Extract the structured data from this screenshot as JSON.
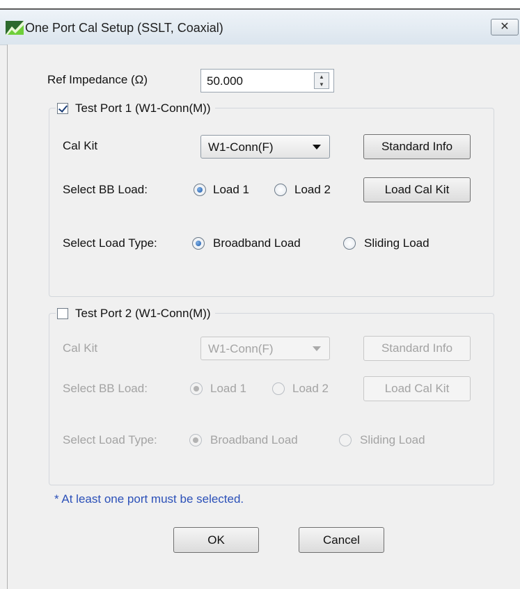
{
  "window": {
    "title": "One Port Cal Setup (SSLT, Coaxial)",
    "close_glyph": "✕"
  },
  "ref_impedance": {
    "label": "Ref Impedance (Ω)",
    "value": "50.000"
  },
  "port1": {
    "enabled": true,
    "checked": true,
    "label": "Test Port 1 (W1-Conn(M))",
    "cal_kit_label": "Cal Kit",
    "cal_kit_value": "W1-Conn(F)",
    "standard_info_button": "Standard Info",
    "bb_load_label": "Select BB Load:",
    "load1_label": "Load 1",
    "load2_label": "Load 2",
    "bb_load_selected": "Load 1",
    "load_cal_kit_button": "Load Cal Kit",
    "load_type_label": "Select Load Type:",
    "broadband_label": "Broadband Load",
    "sliding_label": "Sliding Load",
    "load_type_selected": "Broadband Load"
  },
  "port2": {
    "enabled": false,
    "checked": false,
    "label": "Test Port 2 (W1-Conn(M))",
    "cal_kit_label": "Cal Kit",
    "cal_kit_value": "W1-Conn(F)",
    "standard_info_button": "Standard Info",
    "bb_load_label": "Select BB Load:",
    "load1_label": "Load 1",
    "load2_label": "Load 2",
    "bb_load_selected": "Load 1",
    "load_cal_kit_button": "Load Cal Kit",
    "load_type_label": "Select Load Type:",
    "broadband_label": "Broadband Load",
    "sliding_label": "Sliding Load",
    "load_type_selected": "Broadband Load"
  },
  "note": "* At least one port must be selected.",
  "buttons": {
    "ok": "OK",
    "cancel": "Cancel"
  },
  "colors": {
    "note_text": "#2b50b8",
    "disabled_text": "#a3a3a3",
    "titlebar": "#dbe5ee"
  }
}
